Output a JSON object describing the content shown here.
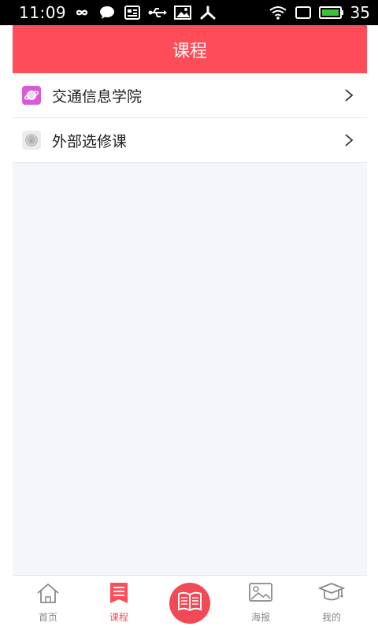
{
  "status_bar": {
    "time": "11:09",
    "battery_level": "35",
    "icons": [
      "infinity-icon",
      "chat-bubble-icon",
      "news-icon",
      "usb-icon",
      "image-icon",
      "debug-icon",
      "wifi-icon",
      "screen-icon",
      "battery-icon"
    ]
  },
  "header": {
    "title": "课程"
  },
  "list": {
    "items": [
      {
        "label": "交通信息学院",
        "icon": "planet-icon",
        "icon_color": "#d85ad8"
      },
      {
        "label": "外部选修课",
        "icon": "coin-icon",
        "icon_color": "#bdbdbd"
      }
    ]
  },
  "tabbar": {
    "tabs": [
      {
        "label": "首页",
        "icon": "home-icon",
        "active": false
      },
      {
        "label": "课程",
        "icon": "list-icon",
        "active": true
      },
      {
        "label": "",
        "icon": "book-icon",
        "active": false
      },
      {
        "label": "海报",
        "icon": "picture-icon",
        "active": false
      },
      {
        "label": "我的",
        "icon": "graduation-cap-icon",
        "active": false
      }
    ]
  },
  "colors": {
    "accent": "#fe4d59",
    "background": "#f3f6fb",
    "status_bar": "#000000"
  }
}
